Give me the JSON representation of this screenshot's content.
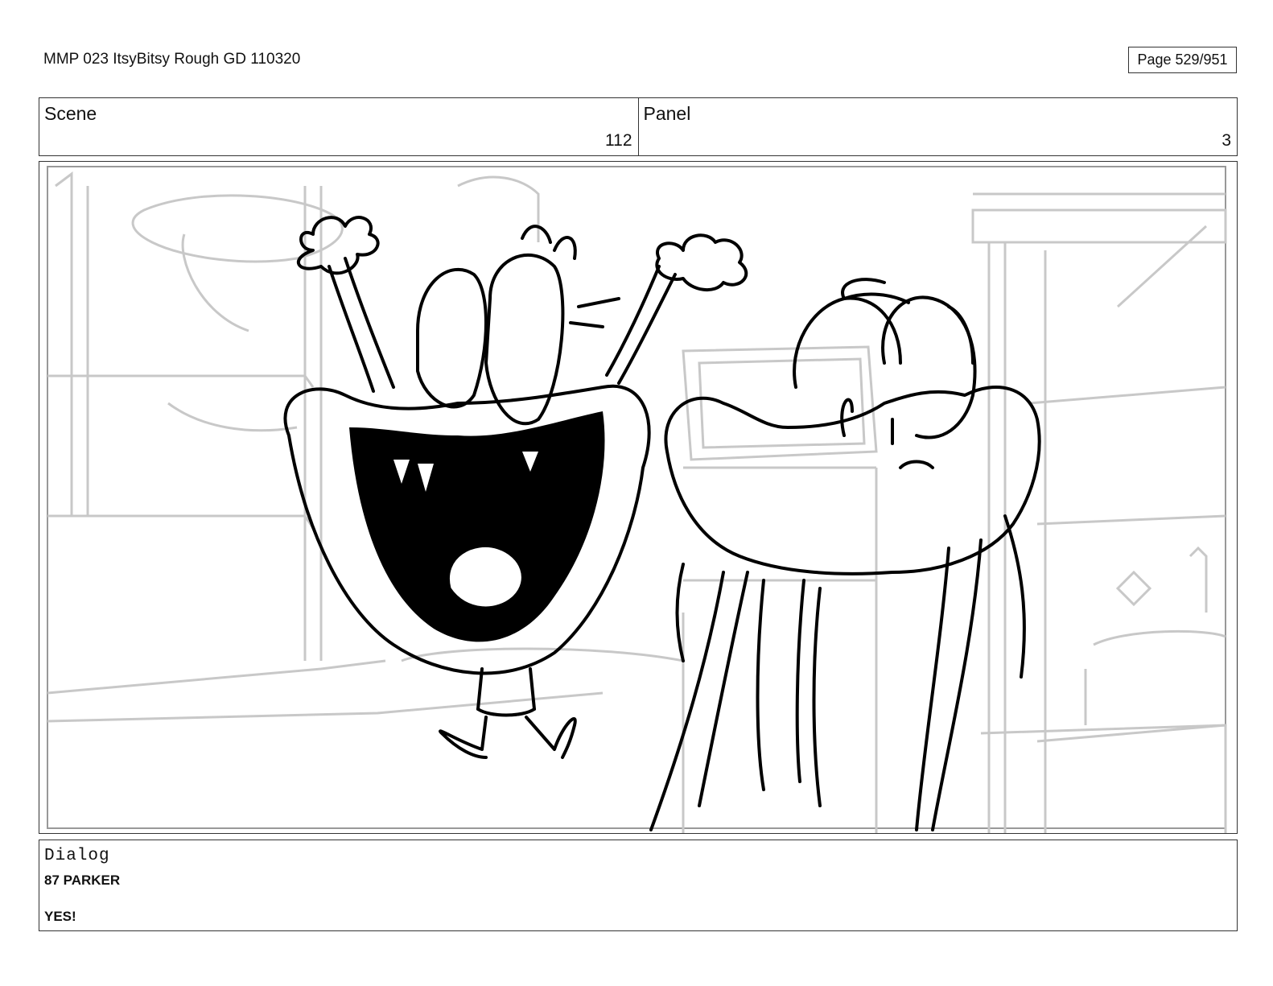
{
  "header": {
    "title": "MMP 023 ItsyBitsy Rough GD 110320",
    "page": "Page 529/951"
  },
  "info": {
    "scene_label": "Scene",
    "scene_value": "112",
    "panel_label": "Panel",
    "panel_value": "3"
  },
  "drawing": {
    "icon": "storyboard-sketch-illustration"
  },
  "dialog": {
    "label": "Dialog",
    "speaker": "87 PARKER",
    "line": "YES!"
  }
}
